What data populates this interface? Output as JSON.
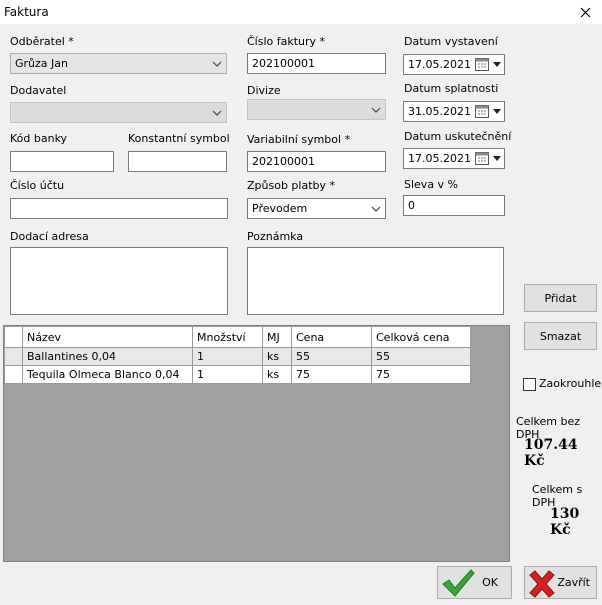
{
  "window": {
    "title": "Faktura"
  },
  "form": {
    "odberatel_label": "Odběratel *",
    "odberatel_value": "Grůza Jan",
    "dodavatel_label": "Dodavatel",
    "dodavatel_value": "",
    "kod_banky_label": "Kód banky",
    "kod_banky_value": "",
    "konst_symbol_label": "Konstantní symbol",
    "konst_symbol_value": "",
    "cislo_uctu_label": "Číslo účtu",
    "cislo_uctu_value": "",
    "dodaci_adresa_label": "Dodací adresa",
    "cislo_faktury_label": "Číslo faktury *",
    "cislo_faktury_value": "202100001",
    "divize_label": "Divize",
    "divize_value": "",
    "var_symbol_label": "Variabilní symbol *",
    "var_symbol_value": "202100001",
    "zpusob_platby_label": "Způsob platby *",
    "zpusob_platby_value": "Převodem",
    "poznamka_label": "Poznámka",
    "datum_vystaveni_label": "Datum vystavení",
    "datum_vystaveni_value": "17.05.2021",
    "datum_splatnosti_label": "Datum splatnosti",
    "datum_splatnosti_value": "31.05.2021",
    "datum_uskutecneni_label": "Datum uskutečnění",
    "datum_uskutecneni_value": "17.05.2021",
    "sleva_label": "Sleva v %",
    "sleva_value": "0"
  },
  "buttons": {
    "pridat": "Přidat",
    "smazat": "Smazat",
    "ok": "OK",
    "zavrit": "Zavřít"
  },
  "table": {
    "headers": [
      "Název",
      "Množství",
      "MJ",
      "Cena",
      "Celková cena"
    ],
    "rows": [
      [
        "Ballantines 0,04",
        "1",
        "ks",
        "55",
        "55"
      ],
      [
        "Tequila Olmeca Blanco 0,04",
        "1",
        "ks",
        "75",
        "75"
      ]
    ]
  },
  "summary": {
    "zaokrouhleni_label": "Zaokrouhlení",
    "bez_dph_label": "Celkem bez DPH",
    "bez_dph_value": "107.44 Kč",
    "s_dph_label": "Celkem s DPH",
    "s_dph_value": "130 Kč"
  },
  "icons": {
    "close": "close-icon",
    "ok": "check-icon",
    "zavrit": "cross-icon",
    "calendar": "calendar-icon"
  },
  "colors": {
    "ok_green": "#3aa53a",
    "close_red": "#d42020",
    "grid_bg": "#a0a0a0"
  }
}
